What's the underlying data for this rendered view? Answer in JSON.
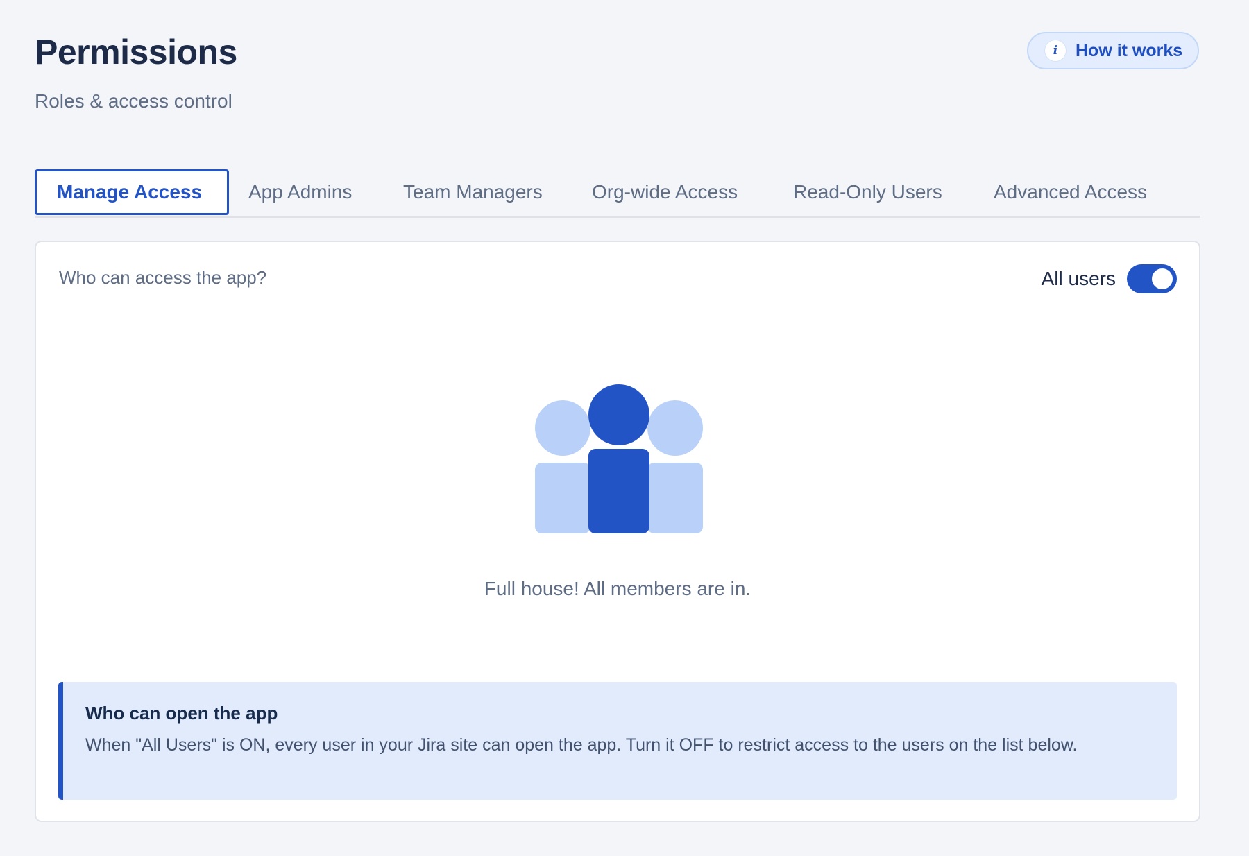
{
  "header": {
    "title": "Permissions",
    "subtitle": "Roles & access control",
    "help_button_label": "How it works",
    "help_icon_glyph": "i"
  },
  "tabs": [
    {
      "label": "Manage Access",
      "active": true
    },
    {
      "label": "App Admins",
      "active": false
    },
    {
      "label": "Team Managers",
      "active": false
    },
    {
      "label": "Org-wide Access",
      "active": false
    },
    {
      "label": "Read-Only Users",
      "active": false
    },
    {
      "label": "Advanced Access",
      "active": false
    }
  ],
  "access": {
    "question": "Who can access the app?",
    "toggle_label": "All users",
    "toggle_on": true,
    "empty_state_icon": "users-group-icon",
    "empty_message": "Full house! All members are in."
  },
  "info_panel": {
    "title": "Who can open the app",
    "text": "When \"All Users\" is ON, every user in your Jira site can open the app. Turn it OFF to restrict access to the users on the list below."
  },
  "colors": {
    "accent": "#2354c6",
    "accent_light": "#b9d1f8",
    "background": "#f3f5f8",
    "info_background": "#e2ebfc"
  }
}
